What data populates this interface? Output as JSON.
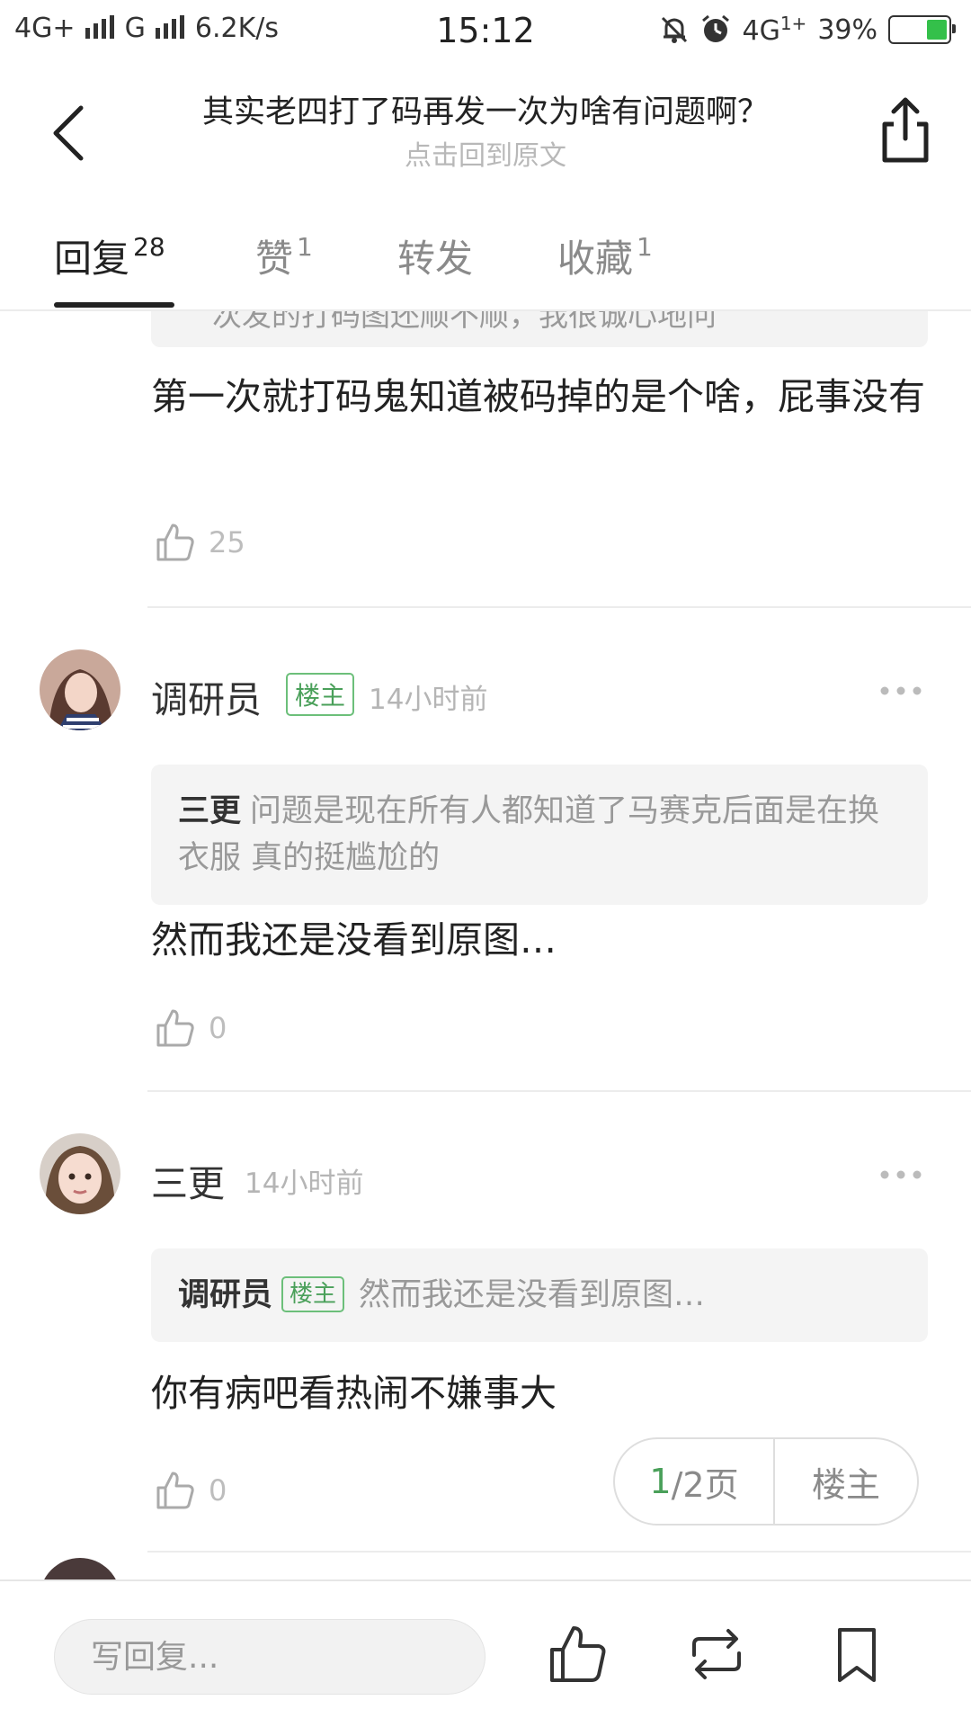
{
  "status_bar": {
    "left_text": "4G+ ıııl G ıııl 6.2K/s",
    "network_1": "4G+",
    "network_2": "G",
    "speed": "6.2K/s",
    "time": "15:12",
    "network_3": "4G",
    "battery_pct_text": "39%",
    "battery_level": 0.39
  },
  "header": {
    "title": "其实老四打了码再发一次为啥有问题啊？",
    "subtitle": "点击回到原文"
  },
  "tabs": [
    {
      "label": "回复",
      "count": "28"
    },
    {
      "label": "赞",
      "count": "1"
    },
    {
      "label": "转发",
      "count": ""
    },
    {
      "label": "收藏",
      "count": "1"
    }
  ],
  "partial_top": {
    "quote_text": "次发的打码图还顺不顺，我很诚心地问",
    "body": "第一次就打码鬼知道被码掉的是个啥，屁事没有",
    "likes": "25"
  },
  "comments": [
    {
      "username": "调研员",
      "badge": "楼主",
      "time": "14小时前",
      "quote_name": "三更",
      "quote_badge": "",
      "quote_text": "问题是现在所有人都知道了马赛克后面是在换衣服 真的挺尴尬的",
      "body": "然而我还是没看到原图…",
      "likes": "0"
    },
    {
      "username": "三更",
      "badge": "",
      "time": "14小时前",
      "quote_name": "调研员",
      "quote_badge": "楼主",
      "quote_text": "然而我还是没看到原图…",
      "body": "你有病吧看热闹不嫌事大",
      "likes": "0"
    }
  ],
  "pager": {
    "current": "1",
    "total_text": "/2页",
    "op_label": "楼主"
  },
  "bottom_bar": {
    "reply_placeholder": "写回复..."
  },
  "colors": {
    "accent_green": "#4aa05a",
    "battery_green": "#34c04a"
  }
}
